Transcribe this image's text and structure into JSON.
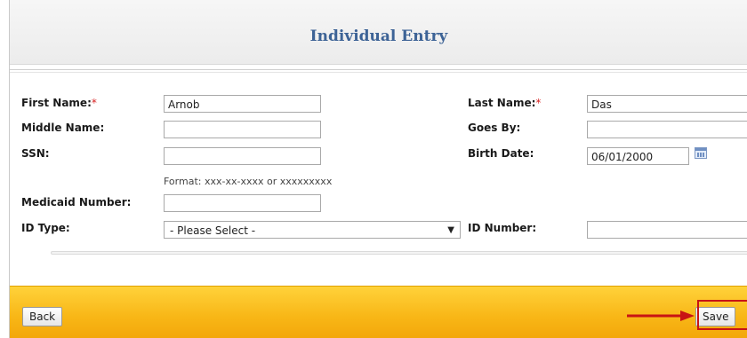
{
  "header": {
    "title": "Individual Entry"
  },
  "form": {
    "first_name": {
      "label": "First Name:",
      "required_mark": "*",
      "value": "Arnob"
    },
    "last_name": {
      "label": "Last Name:",
      "required_mark": "*",
      "value": "Das"
    },
    "middle_name": {
      "label": "Middle Name:",
      "value": ""
    },
    "goes_by": {
      "label": "Goes By:",
      "value": ""
    },
    "ssn": {
      "label": "SSN:",
      "value": "",
      "format_hint": "Format: xxx-xx-xxxx or xxxxxxxxx"
    },
    "birth_date": {
      "label": "Birth Date:",
      "value": "06/01/2000",
      "icon": "calendar-icon"
    },
    "medicaid_number": {
      "label": "Medicaid Number:",
      "value": ""
    },
    "id_type": {
      "label": "ID Type:",
      "selected": "- Please Select -",
      "arrow": "▼"
    },
    "id_number": {
      "label": "ID Number:",
      "value": ""
    }
  },
  "footer": {
    "back_label": "Back",
    "save_label": "Save"
  },
  "colors": {
    "title": "#3d6396",
    "footer": "#f8b616",
    "highlight": "#c81414"
  }
}
